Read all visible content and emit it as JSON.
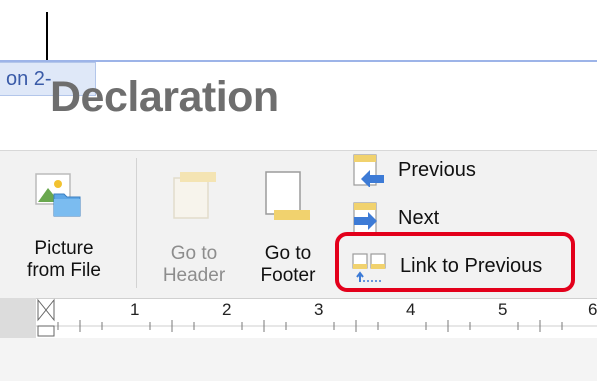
{
  "document": {
    "section_tab": "on 2-",
    "heading": "Declaration"
  },
  "ribbon": {
    "picture_from_file": "Picture\nfrom File",
    "go_to_header": "Go to\nHeader",
    "go_to_footer": "Go to\nFooter",
    "previous": "Previous",
    "next": "Next",
    "link_to_previous": "Link to Previous"
  },
  "ruler": {
    "numbers": [
      "1",
      "2",
      "3",
      "4",
      "5",
      "6"
    ]
  },
  "colors": {
    "highlight": "#e3001b",
    "accent_blue": "#3d7bd6",
    "accent_yellow": "#f1d26e"
  },
  "icons": {
    "picture": "picture-icon",
    "header": "go-to-header-icon",
    "footer": "go-to-footer-icon",
    "previous": "previous-arrow-icon",
    "next": "next-arrow-icon",
    "link": "link-to-previous-icon"
  }
}
